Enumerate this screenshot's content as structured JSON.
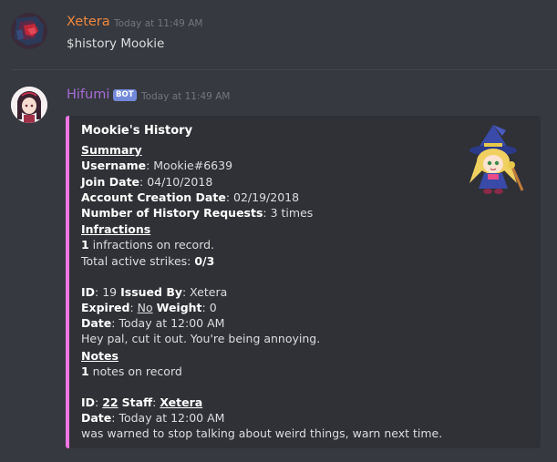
{
  "messages": [
    {
      "author": "Xetera",
      "timestamp": "Today at 11:49 AM",
      "text": "$history Mookie",
      "author_color": "#f0883e"
    },
    {
      "author": "Hifumi",
      "bot_tag": "BOT",
      "timestamp": "Today at 11:49 AM",
      "author_color": "#a66bd8",
      "embed": {
        "accent_color": "#ef77e3",
        "title": "Mookie's History",
        "summary_heading": "Summary",
        "username_label": "Username",
        "username_value": ": Mookie#6639",
        "join_label": "Join Date",
        "join_value": ": 04/10/2018",
        "creation_label": "Account Creation Date",
        "creation_value": ": 02/19/2018",
        "requests_label": "Number of History Requests",
        "requests_value": ": 3 times",
        "infractions_heading": "Infractions",
        "infractions_count": "1",
        "infractions_text": " infractions on record.",
        "strikes_text": "Total active strikes: ",
        "strikes_value": "0/3",
        "infraction": {
          "id_label": "ID",
          "id_value": ": 19 ",
          "issued_label": "Issued By",
          "issued_value": ": Xetera",
          "expired_label": "Expired",
          "expired_sep": ": ",
          "expired_value": "No",
          "weight_label": "Weight",
          "weight_value": ": 0",
          "date_label": "Date",
          "date_value": ": Today at 12:00 AM",
          "reason": "Hey pal, cut it out. You're being annoying."
        },
        "notes_heading": "Notes",
        "notes_count": "1",
        "notes_text": " notes on record",
        "note": {
          "id_label": "ID",
          "id_sep": ": ",
          "id_value": "22",
          "staff_label": "Staff",
          "staff_sep": ": ",
          "staff_value": "Xetera",
          "date_label": "Date",
          "date_value": ": Today at 12:00 AM",
          "text": "was warned to stop talking about weird things, warn next time."
        }
      }
    }
  ]
}
